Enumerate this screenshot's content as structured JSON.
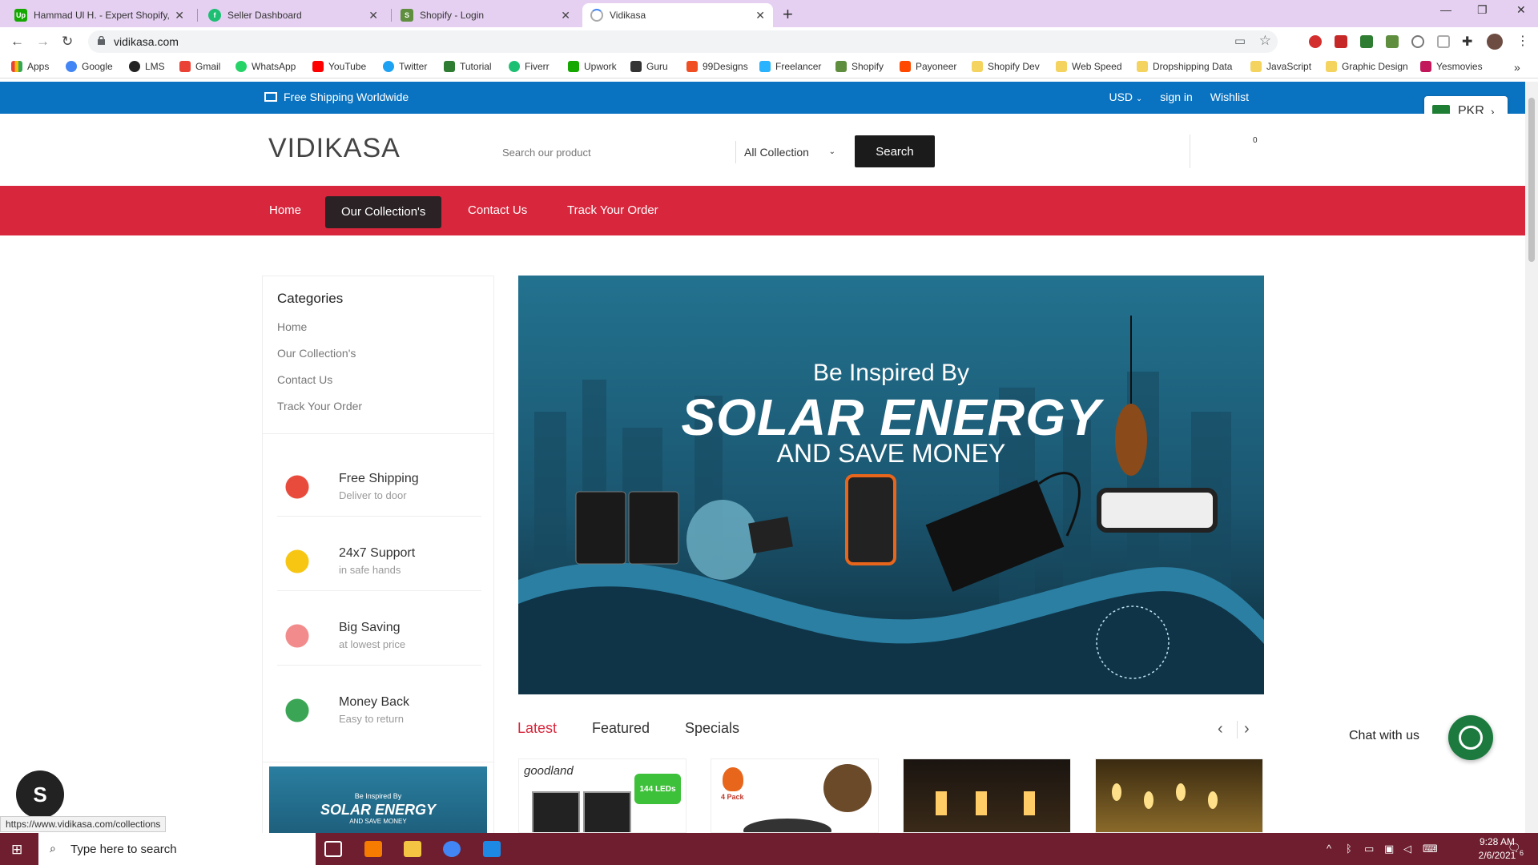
{
  "browser": {
    "tabs": [
      {
        "title": "Hammad Ul H. - Expert Shopify, V",
        "fav": "upwork-icon",
        "color": "#14a800"
      },
      {
        "title": "Seller Dashboard",
        "fav": "fiverr-icon",
        "color": "#1dbf73"
      },
      {
        "title": "Shopify - Login",
        "fav": "shopify-icon",
        "color": "#5e8e3e"
      },
      {
        "title": "Vidikasa",
        "fav": "loading-icon",
        "color": "#c7c7c7"
      }
    ],
    "url": "vidikasa.com",
    "bookmarks": [
      {
        "label": "Apps",
        "color": "#ea4335"
      },
      {
        "label": "Google",
        "color": "#4285f4"
      },
      {
        "label": "LMS",
        "color": "#222222"
      },
      {
        "label": "Gmail",
        "color": "#ea4335"
      },
      {
        "label": "WhatsApp",
        "color": "#25d366"
      },
      {
        "label": "YouTube",
        "color": "#ff0000"
      },
      {
        "label": "Twitter",
        "color": "#1da1f2"
      },
      {
        "label": "Tutorial",
        "color": "#2e7d32"
      },
      {
        "label": "Fiverr",
        "color": "#1dbf73"
      },
      {
        "label": "Upwork",
        "color": "#14a800"
      },
      {
        "label": "Guru",
        "color": "#333333"
      },
      {
        "label": "99Designs",
        "color": "#f04e23"
      },
      {
        "label": "Freelancer",
        "color": "#29b2fe"
      },
      {
        "label": "Shopify",
        "color": "#5e8e3e"
      },
      {
        "label": "Payoneer",
        "color": "#ff4800"
      },
      {
        "label": "Shopify Dev",
        "color": "#f4d35e"
      },
      {
        "label": "Web Speed",
        "color": "#f4d35e"
      },
      {
        "label": "Dropshipping Data",
        "color": "#f4d35e"
      },
      {
        "label": "JavaScript",
        "color": "#f4d35e"
      },
      {
        "label": "Graphic Design",
        "color": "#f4d35e"
      },
      {
        "label": "Yesmovies",
        "color": "#c2185b"
      }
    ],
    "overflow": "»"
  },
  "site": {
    "topstrip": {
      "shipping": "Free Shipping Worldwide",
      "currency": "USD",
      "signin": "sign in",
      "wishlist": "Wishlist"
    },
    "currency_widget": "PKR",
    "logo": "VIDIKASA",
    "search": {
      "placeholder": "Search our product",
      "collection": "All Collection",
      "button": "Search"
    },
    "cart_count": "0",
    "nav": [
      "Home",
      "Our Collection's",
      "Contact Us",
      "Track Your Order"
    ],
    "sidebar": {
      "title": "Categories",
      "items": [
        "Home",
        "Our Collection's",
        "Contact Us",
        "Track Your Order"
      ],
      "features": [
        {
          "title": "Free Shipping",
          "sub": "Deliver to door",
          "color": "#e84b3c"
        },
        {
          "title": "24x7 Support",
          "sub": "in safe hands",
          "color": "#f7c613"
        },
        {
          "title": "Big Saving",
          "sub": "at lowest price",
          "color": "#f28b8b"
        },
        {
          "title": "Money Back",
          "sub": "Easy to return",
          "color": "#3aa655"
        }
      ],
      "banner": {
        "l1": "Be Inspired By",
        "l2": "SOLAR ENERGY",
        "l3": "AND SAVE MONEY"
      }
    },
    "hero": {
      "line1": "Be Inspired By",
      "line2": "SOLAR ENERGY",
      "line3": "AND SAVE MONEY"
    },
    "product_tabs": [
      "Latest",
      "Featured",
      "Specials"
    ],
    "product_cards": {
      "card1_brand": "goodland",
      "card1_badge": "144 LEDs",
      "card2_badge": "4 Pack"
    },
    "chat": "Chat with us",
    "status_url": "https://www.vidikasa.com/collections"
  },
  "taskbar": {
    "search_placeholder": "Type here to search",
    "time": "9:28 AM",
    "date": "2/6/2021",
    "notifications": "6"
  },
  "colors": {
    "accent": "#d8263c",
    "topstrip": "#0a73c1",
    "nav_active": "#2a2224"
  }
}
